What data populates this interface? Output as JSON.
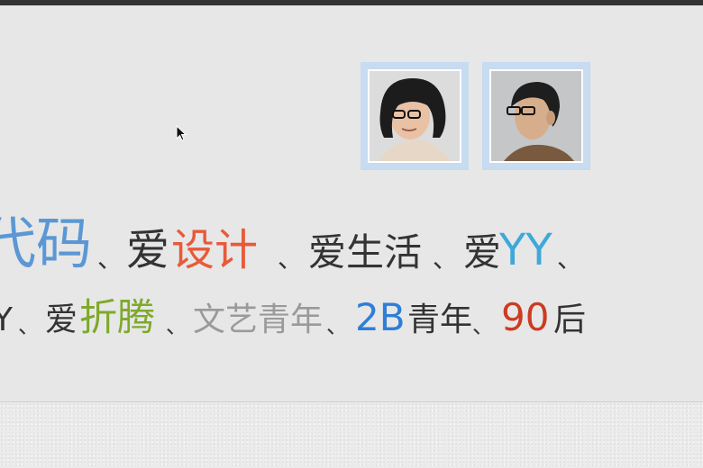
{
  "colors": {
    "blue": "#5b97d4",
    "orange": "#e85a38",
    "cyan": "#3fa8d9",
    "green": "#7ea92a",
    "gray": "#9a9a9a",
    "bright_blue": "#2d7fd8",
    "red": "#cc3b23",
    "dark": "#333333",
    "avatar_frame": "#c7dbf1"
  },
  "line1": {
    "code": "代码",
    "sep1": "、",
    "love1": "爱",
    "design": "设计",
    "sep2": "、",
    "love_life": "爱生活",
    "sep3": "、",
    "love2": "爱",
    "yy": "YY",
    "sep4": "、"
  },
  "line2": {
    "y": "Y",
    "sep1": "、",
    "love": "爱",
    "tinker": "折腾",
    "sep2": "、",
    "artsy": "文艺青年",
    "sep3": "、",
    "two_b": "2B",
    "youth": "青年",
    "sep4": "、",
    "ninety": "90",
    "after": "后"
  }
}
